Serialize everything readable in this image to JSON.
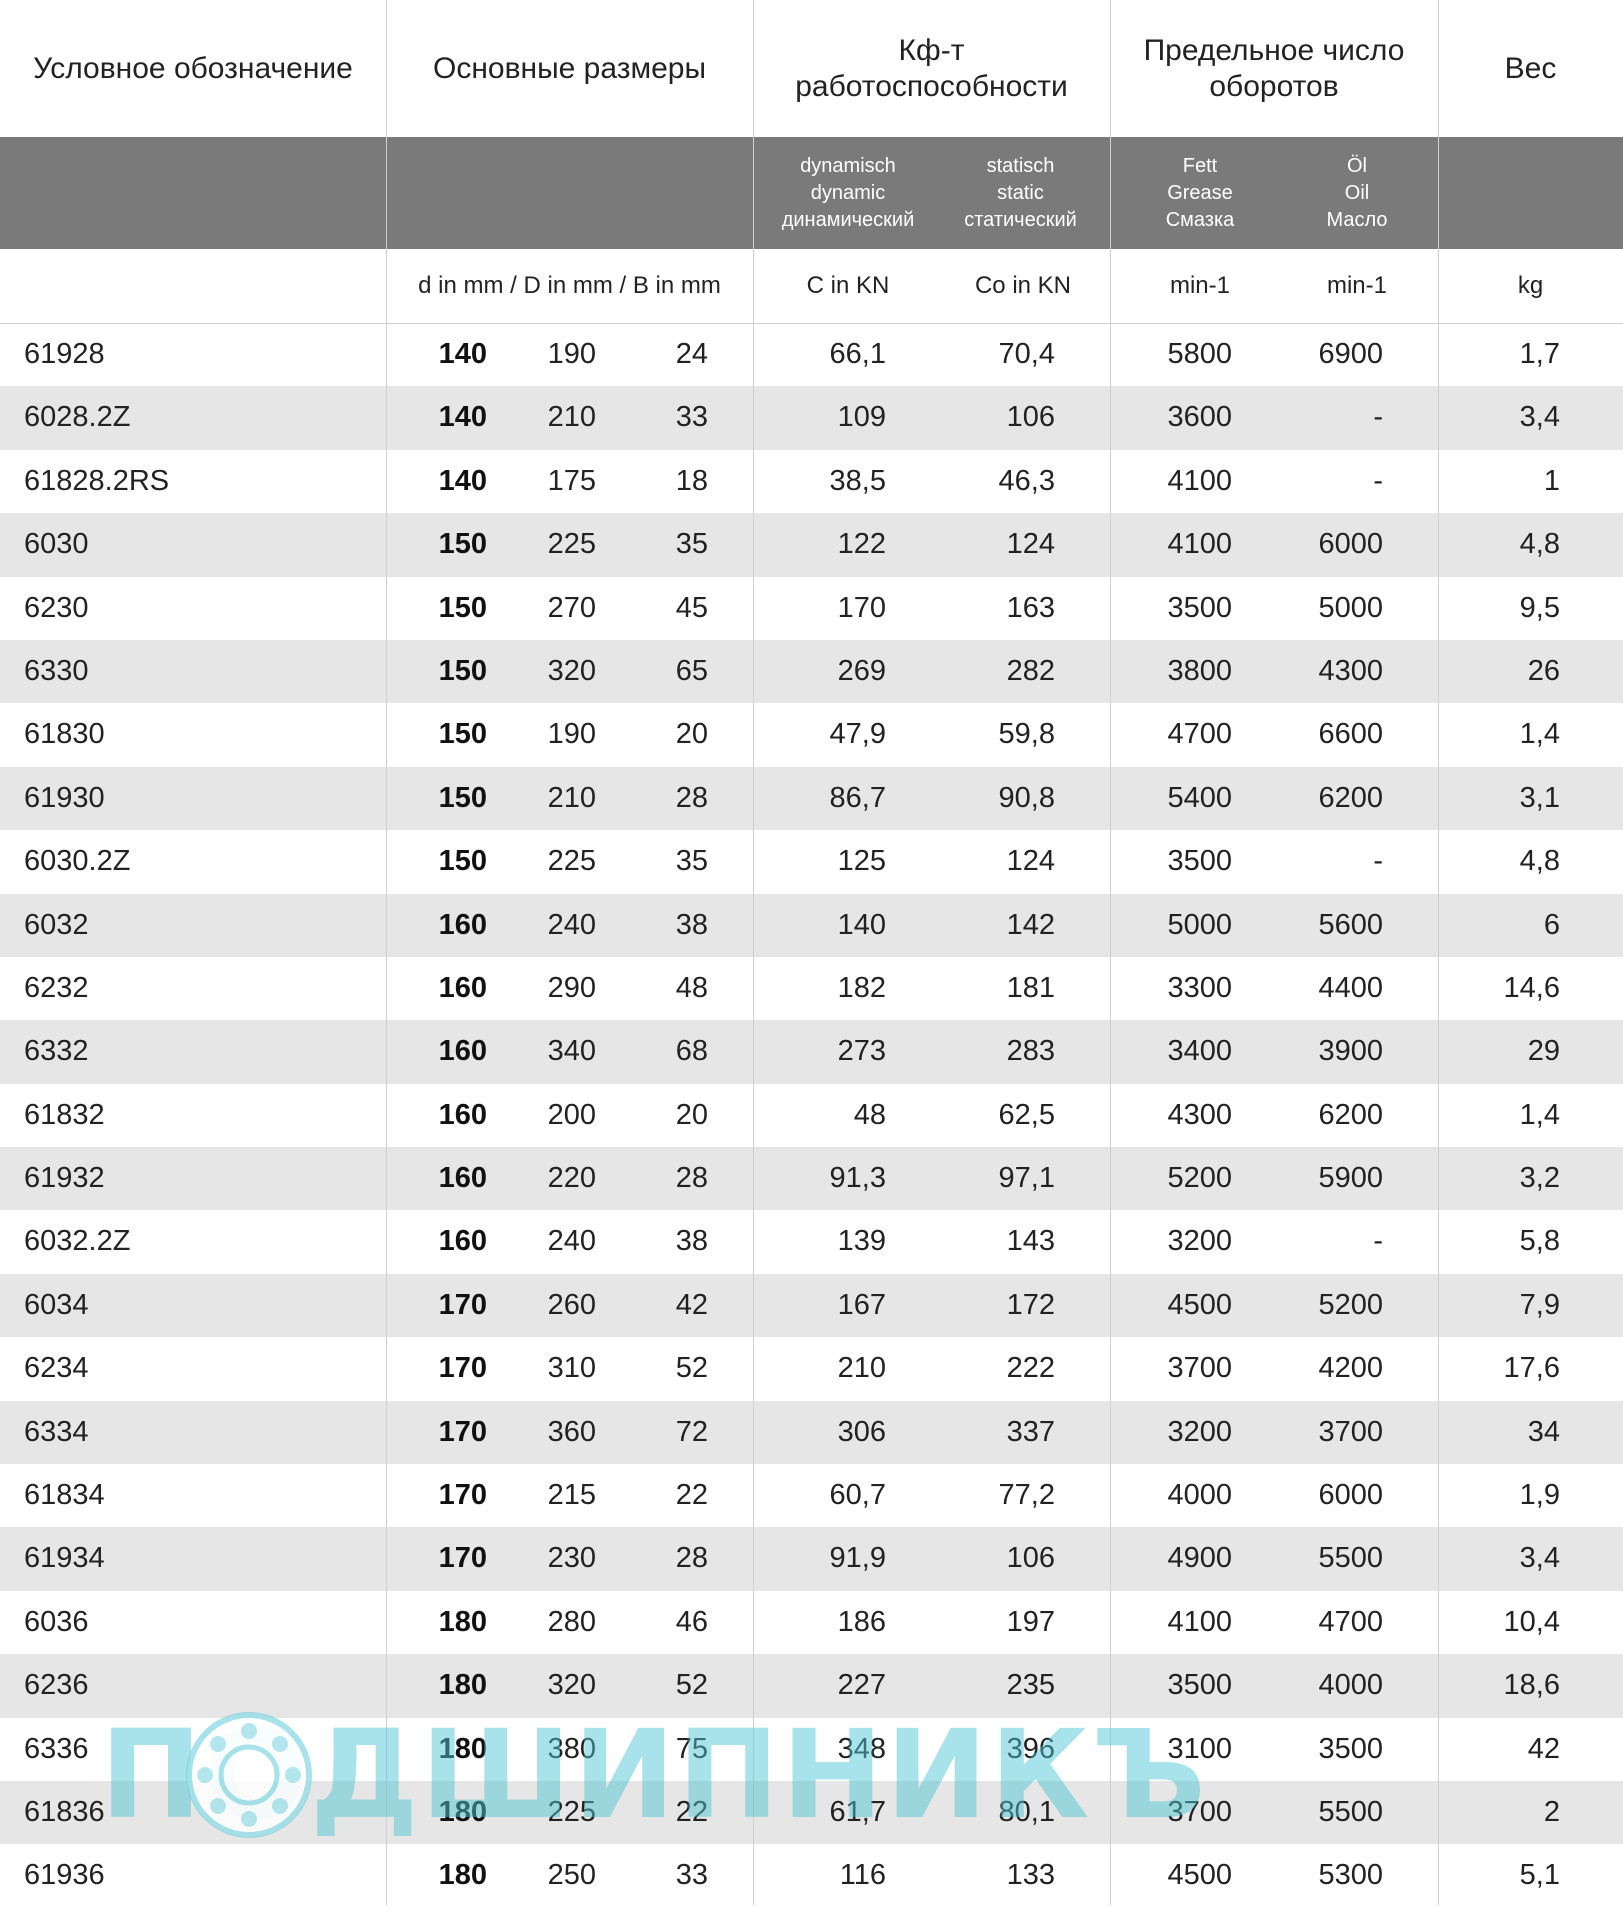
{
  "header": {
    "designation": "Условное обозначение",
    "main_dimensions": "Основные размеры",
    "load_rating_line1": "Кф-т",
    "load_rating_line2": "работоспособности",
    "speed_limit_line1": "Предельное число",
    "speed_limit_line2": "оборотов",
    "weight": "Вес"
  },
  "subheader": {
    "dynamic": [
      "dynamisch",
      "dynamic",
      "динамический"
    ],
    "static": [
      "statisch",
      "static",
      "статический"
    ],
    "grease": [
      "Fett",
      "Grease",
      "Смазка"
    ],
    "oil": [
      "Öl",
      "Oil",
      "Масло"
    ]
  },
  "units": {
    "dimensions": "d in mm / D in mm / B in mm",
    "c": "C in KN",
    "co": "Co in KN",
    "grease": "min-1",
    "oil": "min-1",
    "weight": "kg"
  },
  "rows": [
    [
      "61928",
      "140",
      "190",
      "24",
      "66,1",
      "70,4",
      "5800",
      "6900",
      "1,7"
    ],
    [
      "6028.2Z",
      "140",
      "210",
      "33",
      "109",
      "106",
      "3600",
      "-",
      "3,4"
    ],
    [
      "61828.2RS",
      "140",
      "175",
      "18",
      "38,5",
      "46,3",
      "4100",
      "-",
      "1"
    ],
    [
      "6030",
      "150",
      "225",
      "35",
      "122",
      "124",
      "4100",
      "6000",
      "4,8"
    ],
    [
      "6230",
      "150",
      "270",
      "45",
      "170",
      "163",
      "3500",
      "5000",
      "9,5"
    ],
    [
      "6330",
      "150",
      "320",
      "65",
      "269",
      "282",
      "3800",
      "4300",
      "26"
    ],
    [
      "61830",
      "150",
      "190",
      "20",
      "47,9",
      "59,8",
      "4700",
      "6600",
      "1,4"
    ],
    [
      "61930",
      "150",
      "210",
      "28",
      "86,7",
      "90,8",
      "5400",
      "6200",
      "3,1"
    ],
    [
      "6030.2Z",
      "150",
      "225",
      "35",
      "125",
      "124",
      "3500",
      "-",
      "4,8"
    ],
    [
      "6032",
      "160",
      "240",
      "38",
      "140",
      "142",
      "5000",
      "5600",
      "6"
    ],
    [
      "6232",
      "160",
      "290",
      "48",
      "182",
      "181",
      "3300",
      "4400",
      "14,6"
    ],
    [
      "6332",
      "160",
      "340",
      "68",
      "273",
      "283",
      "3400",
      "3900",
      "29"
    ],
    [
      "61832",
      "160",
      "200",
      "20",
      "48",
      "62,5",
      "4300",
      "6200",
      "1,4"
    ],
    [
      "61932",
      "160",
      "220",
      "28",
      "91,3",
      "97,1",
      "5200",
      "5900",
      "3,2"
    ],
    [
      "6032.2Z",
      "160",
      "240",
      "38",
      "139",
      "143",
      "3200",
      "-",
      "5,8"
    ],
    [
      "6034",
      "170",
      "260",
      "42",
      "167",
      "172",
      "4500",
      "5200",
      "7,9"
    ],
    [
      "6234",
      "170",
      "310",
      "52",
      "210",
      "222",
      "3700",
      "4200",
      "17,6"
    ],
    [
      "6334",
      "170",
      "360",
      "72",
      "306",
      "337",
      "3200",
      "3700",
      "34"
    ],
    [
      "61834",
      "170",
      "215",
      "22",
      "60,7",
      "77,2",
      "4000",
      "6000",
      "1,9"
    ],
    [
      "61934",
      "170",
      "230",
      "28",
      "91,9",
      "106",
      "4900",
      "5500",
      "3,4"
    ],
    [
      "6036",
      "180",
      "280",
      "46",
      "186",
      "197",
      "4100",
      "4700",
      "10,4"
    ],
    [
      "6236",
      "180",
      "320",
      "52",
      "227",
      "235",
      "3500",
      "4000",
      "18,6"
    ],
    [
      "6336",
      "180",
      "380",
      "75",
      "348",
      "396",
      "3100",
      "3500",
      "42"
    ],
    [
      "61836",
      "180",
      "225",
      "22",
      "61,7",
      "80,1",
      "3700",
      "5500",
      "2"
    ],
    [
      "61936",
      "180",
      "250",
      "33",
      "116",
      "133",
      "4500",
      "5300",
      "5,1"
    ]
  ],
  "watermark": {
    "text": "ПОДШИПНИКЪ",
    "color": "#4ec4d4"
  },
  "colors": {
    "subheader_bg": "#7a7a7a",
    "row_alt_bg": "#e6e6e6",
    "divider": "#cfcfcf"
  }
}
